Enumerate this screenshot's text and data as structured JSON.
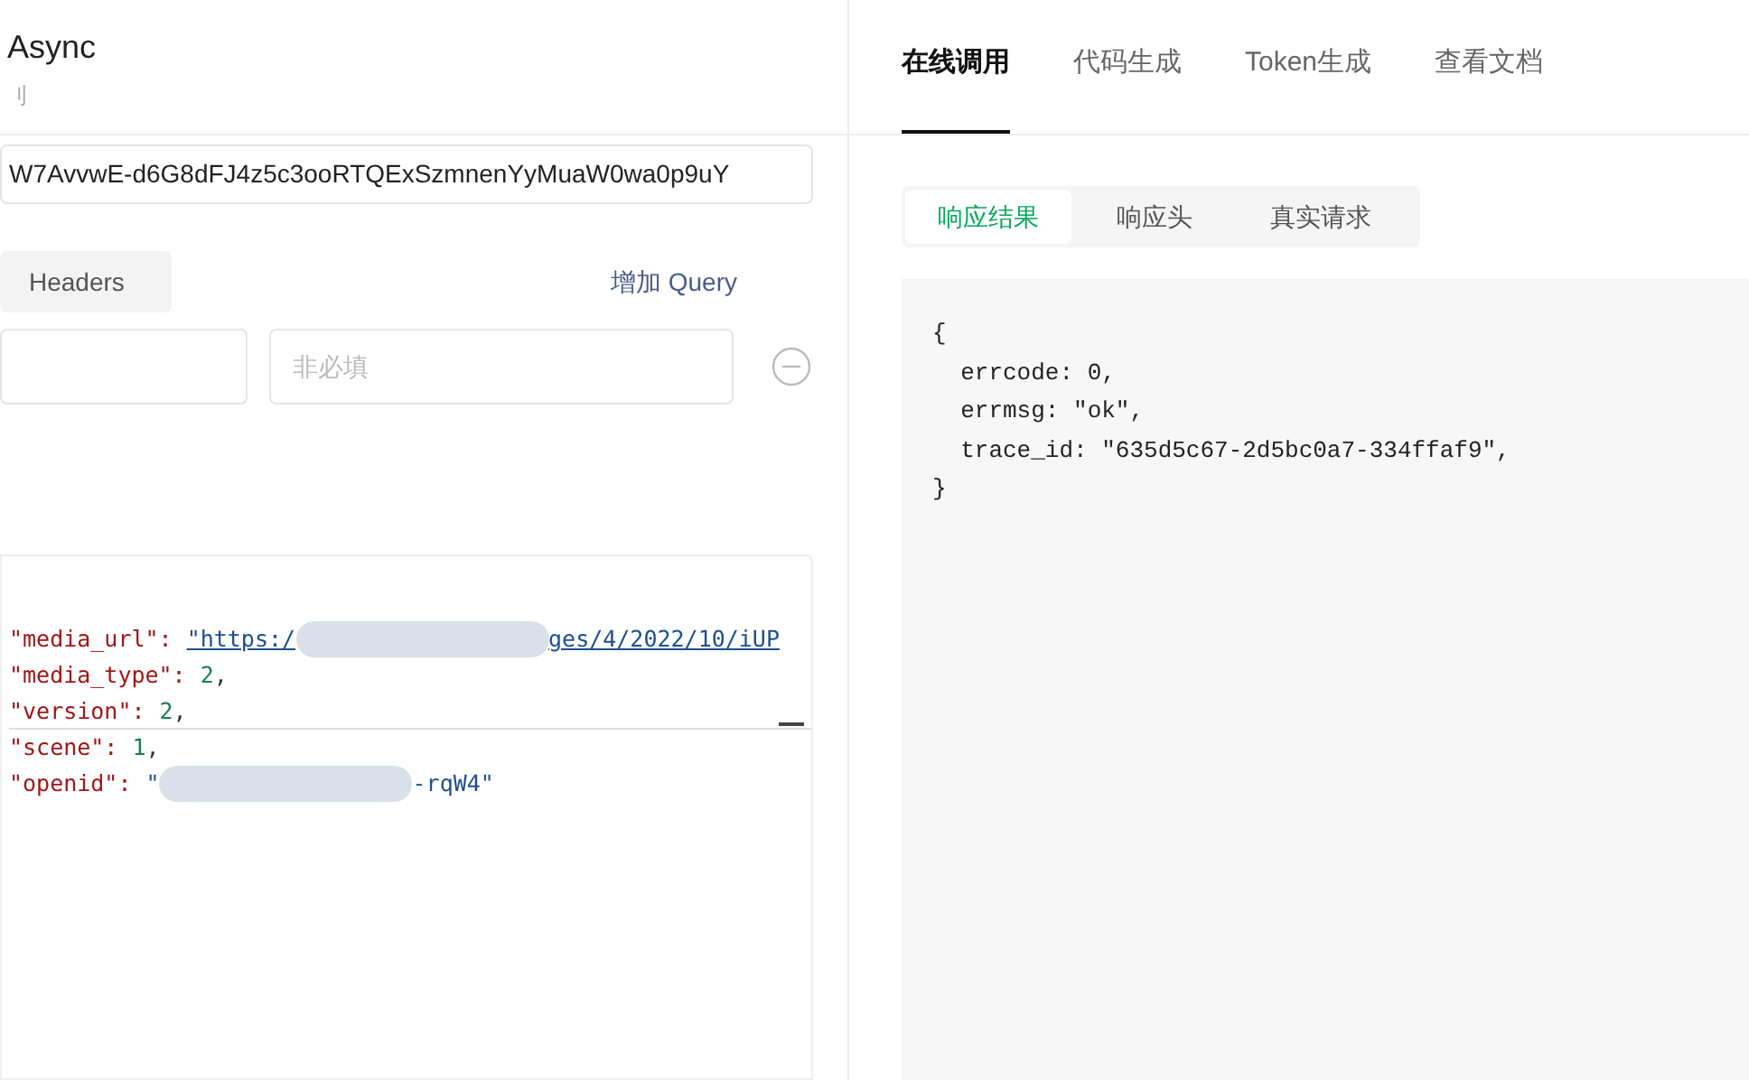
{
  "left": {
    "title": "Async",
    "subtitle": "刂",
    "token_value": "W7AvvwE-d6G8dFJ4z5c3ooRTQExSzmnenYyMuaW0wa0p9uY",
    "param_tab": {
      "label": "Headers",
      "selected": true
    },
    "add_link": "增加 Query",
    "param_row": {
      "value_placeholder": "非必填"
    },
    "body_lines": [
      {
        "key": "\"media_url\":",
        "parts": [
          {
            "kind": "link",
            "text": "\"https:/"
          },
          {
            "kind": "redacted"
          },
          {
            "kind": "link",
            "text": "ges/4/2022/10/iUP"
          }
        ]
      },
      {
        "key": "\"media_type\":",
        "parts": [
          {
            "kind": "number",
            "text": "2"
          },
          {
            "kind": "plain",
            "text": ","
          }
        ]
      },
      {
        "key": "\"version\":",
        "parts": [
          {
            "kind": "number",
            "text": "2"
          },
          {
            "kind": "plain",
            "text": ","
          }
        ]
      },
      {
        "key": "\"scene\":",
        "parts": [
          {
            "kind": "number",
            "text": "1"
          },
          {
            "kind": "plain",
            "text": ","
          }
        ]
      },
      {
        "key": "\"openid\":",
        "parts": [
          {
            "kind": "string",
            "text": "\""
          },
          {
            "kind": "redacted"
          },
          {
            "kind": "string",
            "text": "-rqW4\""
          }
        ]
      }
    ]
  },
  "right": {
    "tabs": [
      {
        "label": "在线调用",
        "selected": true
      },
      {
        "label": "代码生成",
        "selected": false
      },
      {
        "label": "Token生成",
        "selected": false
      },
      {
        "label": "查看文档",
        "selected": false
      }
    ],
    "sub_tabs": [
      {
        "label": "响应结果",
        "selected": true
      },
      {
        "label": "响应头",
        "selected": false
      },
      {
        "label": "真实请求",
        "selected": false
      }
    ],
    "response_lines": [
      "{",
      "  errcode: 0,",
      "  errmsg: \"ok\",",
      "  trace_id: \"635d5c67-2d5bc0a7-334ffaf9\",",
      "}"
    ]
  }
}
